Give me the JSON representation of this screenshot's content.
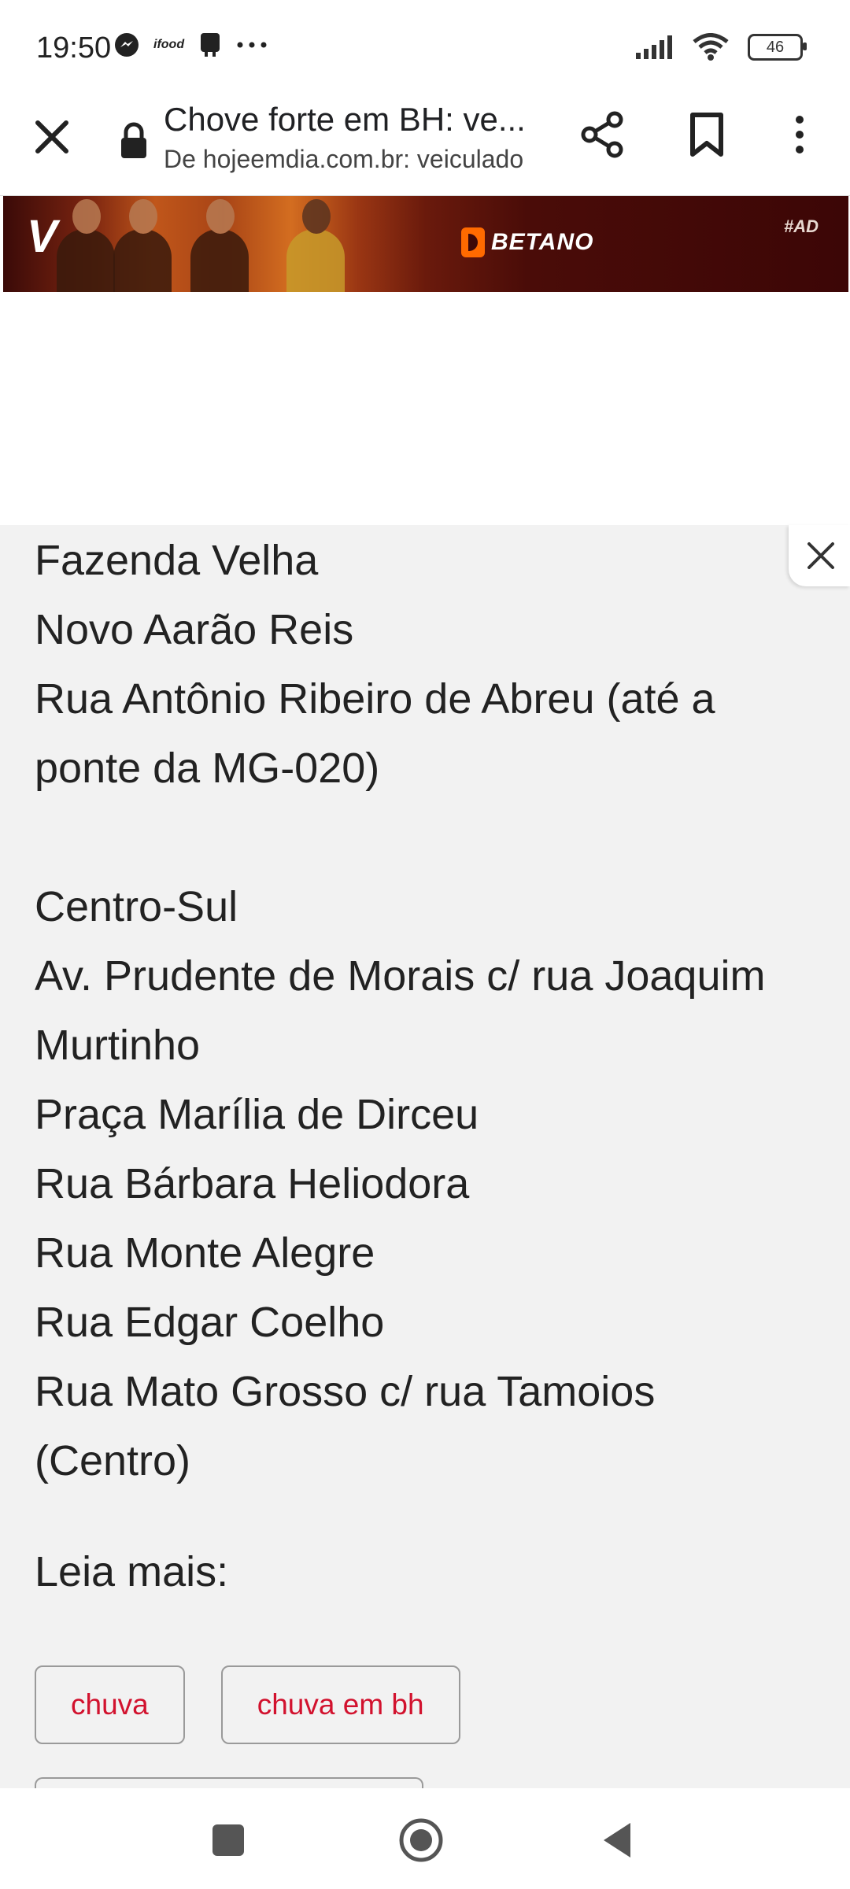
{
  "status_bar": {
    "time": "19:50",
    "left_icons": [
      "messenger-icon",
      "ifood-icon",
      "sim-icon",
      "more-dots-icon"
    ],
    "ifood_text": "ifood",
    "battery": "46"
  },
  "toolbar": {
    "title": "Chove forte em BH: ve...",
    "url": "De hojeemdia.com.br: veiculado"
  },
  "ad": {
    "brand": "BETANO",
    "tag": "#AD"
  },
  "article": {
    "lines": [
      "Fazenda Velha",
      "Novo Aarão Reis",
      "Rua Antônio Ribeiro de Abreu (até a ponte da MG-020)",
      "",
      "Centro-Sul",
      "Av. Prudente de Morais c/ rua Joaquim Murtinho",
      "Praça Marília de Dirceu",
      "Rua Bárbara Heliodora",
      "Rua Monte Alegre",
      "Rua Edgar Coelho",
      "Rua Mato Grosso c/ rua Tamoios (Centro)"
    ],
    "read_more": "Leia mais:"
  },
  "tags": [
    "chuva",
    "chuva em bh"
  ],
  "colors": {
    "tag_text": "#d2122e",
    "page_bg": "#f2f2f2",
    "ad_dark": "#3c0606",
    "brand_orange": "#ff6a00"
  }
}
